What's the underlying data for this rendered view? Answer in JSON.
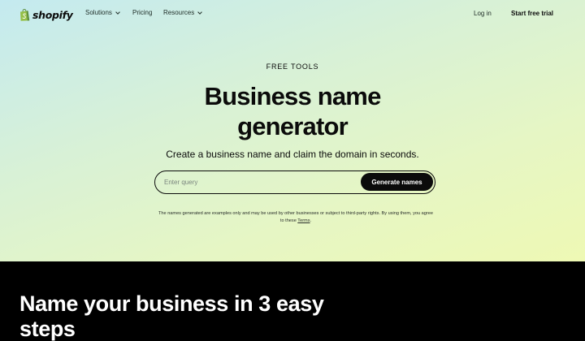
{
  "nav": {
    "brand": "shopify",
    "links": [
      {
        "label": "Solutions",
        "dropdown": true
      },
      {
        "label": "Pricing",
        "dropdown": false
      },
      {
        "label": "Resources",
        "dropdown": true
      }
    ],
    "login": "Log in",
    "cta": "Start free trial"
  },
  "hero": {
    "eyebrow": "FREE TOOLS",
    "title": "Business name generator",
    "subtitle": "Create a business name and claim the domain in seconds.",
    "search": {
      "placeholder": "Enter query",
      "value": "",
      "button": "Generate names"
    },
    "disclaimer_text": "The names generated are examples only and may be used by other businesses or subject to third-party rights. By using them, you agree to these",
    "disclaimer_link": "Terms",
    "disclaimer_end": "."
  },
  "section": {
    "title": "Name your business in 3 easy steps"
  },
  "colors": {
    "brand_green": "#95bf47",
    "button_bg": "#0b0b0b",
    "dark_section": "#000000"
  },
  "icons": {
    "logo": "shopify-bag-icon",
    "dropdown": "chevron-down-icon"
  }
}
